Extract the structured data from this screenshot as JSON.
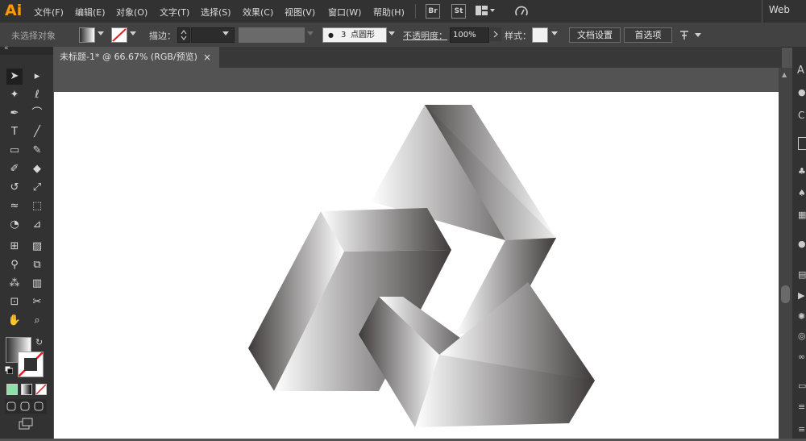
{
  "app": {
    "logo": "Ai",
    "workspace": "Web"
  },
  "menu": [
    "文件(F)",
    "编辑(E)",
    "对象(O)",
    "文字(T)",
    "选择(S)",
    "效果(C)",
    "视图(V)",
    "窗口(W)",
    "帮助(H)"
  ],
  "menu_icons": {
    "bridge": "Br",
    "stock": "St"
  },
  "control": {
    "selection_status": "未选择对象",
    "stroke_label": "描边：",
    "brush_size": "3",
    "brush_shape": "点圆形",
    "opacity_label": "不透明度：",
    "opacity_value": "100%",
    "style_label": "样式：",
    "doc_setup_button": "文档设置",
    "prefs_button": "首选项"
  },
  "document": {
    "tab_title": "未标题-1* @ 66.67% (RGB/预览)",
    "close": "×"
  },
  "colors": {
    "accent": "#ff9a00",
    "gradient_dark": "#3e3a3a",
    "gradient_light": "#ffffff"
  },
  "tools": [
    "selection-icon",
    "direct-selection-icon",
    "magic-wand-icon",
    "lasso-icon",
    "pen-icon",
    "curvature-icon",
    "type-icon",
    "line-icon",
    "rectangle-icon",
    "paintbrush-icon",
    "shaper-icon",
    "eraser-icon",
    "rotate-icon",
    "scale-icon",
    "warp-icon",
    "free-transform-icon",
    "shape-builder-icon",
    "perspective-icon",
    "mesh-icon",
    "gradient-icon",
    "eyedropper-icon",
    "blend-icon",
    "symbol-sprayer-icon",
    "column-graph-icon",
    "artboard-icon",
    "slice-icon",
    "hand-icon",
    "zoom-icon"
  ]
}
